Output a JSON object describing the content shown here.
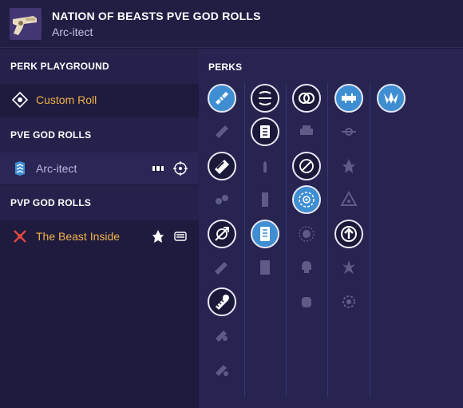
{
  "header": {
    "weapon_name": "NATION OF BEASTS PVE GOD ROLLS",
    "subtitle": "Arc-itect"
  },
  "sidebar": {
    "playground_heading": "PERK PLAYGROUND",
    "custom_roll_label": "Custom Roll",
    "pve_heading": "PVE GOD ROLLS",
    "pve_roll_label": "Arc-itect",
    "pvp_heading": "PVP GOD ROLLS",
    "pvp_roll_label": "The Beast Inside"
  },
  "perks": {
    "heading": "PERKS",
    "columns": [
      {
        "column": 1,
        "items": [
          "selected-blue",
          "inactive",
          "selected",
          "inactive",
          "selected",
          "inactive",
          "selected",
          "inactive",
          "inactive"
        ]
      },
      {
        "column": 2,
        "items": [
          "selected",
          "selected",
          "inactive",
          "inactive",
          "selected-blue",
          "inactive"
        ]
      },
      {
        "column": 3,
        "items": [
          "selected",
          "inactive",
          "selected",
          "selected-blue",
          "inactive",
          "inactive",
          "inactive"
        ]
      },
      {
        "column": 4,
        "items": [
          "selected-blue",
          "inactive",
          "inactive",
          "inactive",
          "selected",
          "inactive",
          "inactive"
        ]
      },
      {
        "column": 5,
        "items": [
          "selected-blue"
        ]
      }
    ]
  },
  "colors": {
    "accent_orange": "#f2b24a",
    "perk_blue": "#3f8ed2",
    "panel_bg": "#272452",
    "sidebar_bg": "#1e1b3e"
  }
}
